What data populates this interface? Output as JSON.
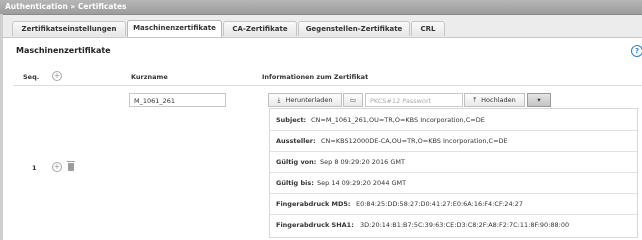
{
  "titlebar": {
    "title": "Authentication » Certificates"
  },
  "tabs": [
    {
      "label": "Zertifikatseinstellungen",
      "active": false
    },
    {
      "label": "Maschinenzertifikate",
      "active": true
    },
    {
      "label": "CA-Zertifikate",
      "active": false
    },
    {
      "label": "Gegenstellen-Zertifikate",
      "active": false
    },
    {
      "label": "CRL",
      "active": false
    }
  ],
  "section": {
    "title": "Maschinenzertifikate",
    "help_icon": "question-circle-icon"
  },
  "table": {
    "headers": {
      "seq": "Seq.",
      "short_name": "Kurzname",
      "info": "Informationen zum Zertifikat"
    }
  },
  "row": {
    "seq": "1",
    "short_name": "M_1061_261",
    "download_label": "Herunterladen",
    "password_placeholder": "PKCS#12 Passwort",
    "upload_label": "Hochladen",
    "details": [
      {
        "label": "Subject:",
        "value": "CN=M_1061_261,OU=TR,O=KBS Incorporation,C=DE"
      },
      {
        "label": "Aussteller:",
        "value": "CN=KBS12000DE-CA,OU=TR,O=KBS Incorporation,C=DE"
      },
      {
        "label": "Gültig von:",
        "value": "Sep 8 09:29:20 2016 GMT"
      },
      {
        "label": "Gültig bis:",
        "value": "Sep 14 09:29:20 2044 GMT"
      },
      {
        "label": "Fingerabdruck MD5:",
        "value": "E0:84:25:DD:58:27:D0:41:27:E0:6A:16:F4:CF:24:27"
      },
      {
        "label": "Fingerabdruck SHA1:",
        "value": "3D:20:14:B1:B7:5C:39:63:CE:D3:C8:2F:A8:F2:7C:11:8F:90:88:00"
      }
    ]
  }
}
